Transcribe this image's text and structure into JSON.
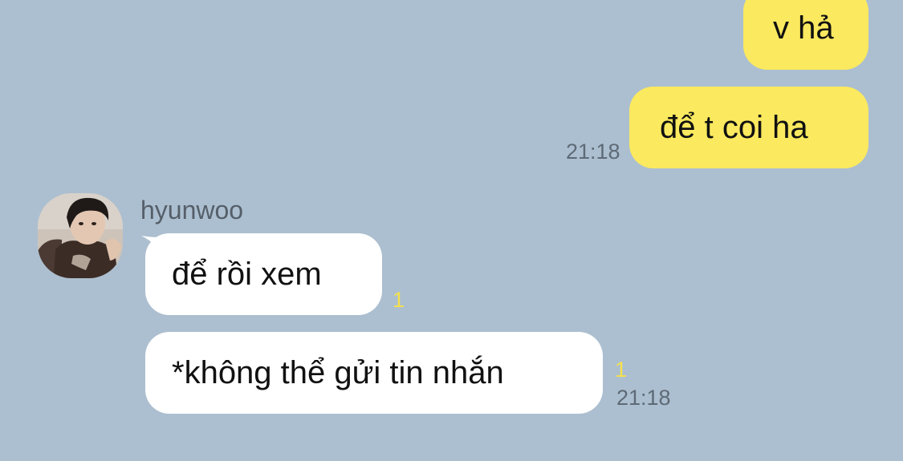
{
  "messages": {
    "out_1": {
      "text": "v hả"
    },
    "out_2": {
      "text": "để t coi ha",
      "time": "21:18"
    },
    "in_1": {
      "text": "để rồi xem",
      "unread": "1"
    },
    "in_2": {
      "text": "*không thể gửi tin nhắn",
      "unread": "1",
      "time": "21:18"
    }
  },
  "sender": {
    "name": "hyunwoo"
  },
  "colors": {
    "background": "#acbfd0",
    "outgoing_bubble": "#fbe95f",
    "incoming_bubble": "#ffffff",
    "unread_count": "#f6e04e"
  },
  "icons": {
    "avatar": "profile-photo"
  }
}
